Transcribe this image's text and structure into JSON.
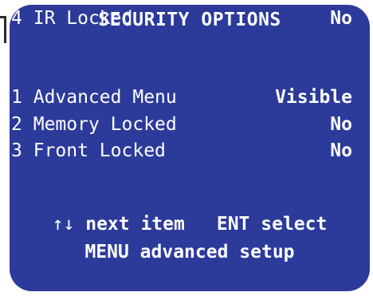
{
  "screen": {
    "title": "SECURITY OPTIONS",
    "items": [
      {
        "number": "1",
        "label": "Advanced Menu",
        "value": "Visible"
      },
      {
        "number": "2",
        "label": "Memory Locked",
        "value": "No"
      },
      {
        "number": "3",
        "label": "Front Locked",
        "value": "No"
      },
      {
        "number": "4",
        "label": "IR Locked",
        "value": "No"
      }
    ]
  },
  "help": {
    "arrows_glyph": "↑↓",
    "next_item": "next item",
    "ent": "ENT",
    "select": "select",
    "menu_line": "MENU advanced setup"
  },
  "colors": {
    "background": "#2c3a9a",
    "text": "#ffffff"
  }
}
